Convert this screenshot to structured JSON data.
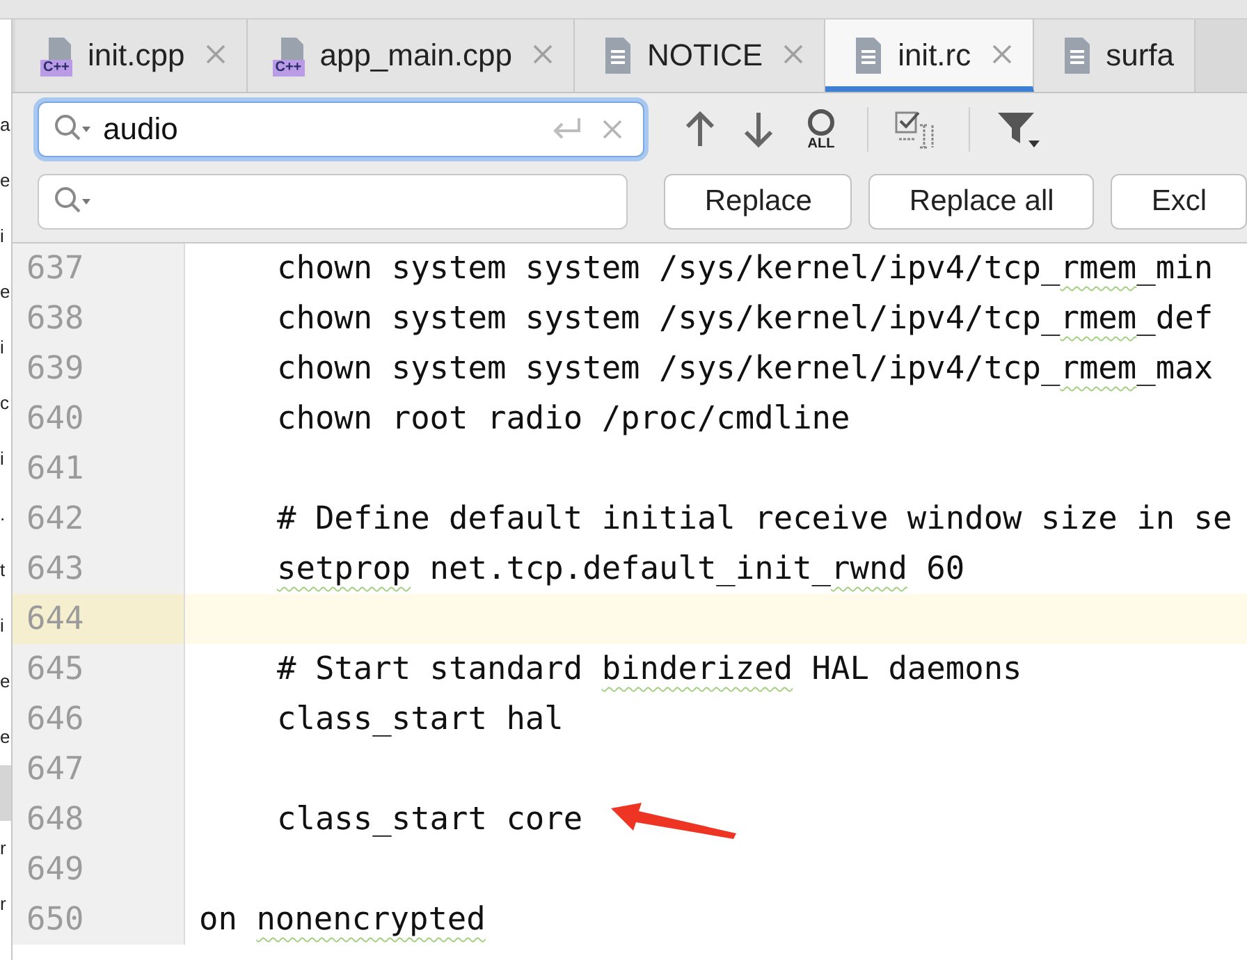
{
  "side_panel": {
    "rows": [
      {
        "text": "a",
        "selected": false
      },
      {
        "text": "e",
        "selected": false
      },
      {
        "text": "i",
        "selected": false
      },
      {
        "text": "e",
        "selected": false
      },
      {
        "text": "i",
        "selected": false
      },
      {
        "text": "c",
        "selected": false
      },
      {
        "text": "i",
        "selected": false
      },
      {
        "text": ".",
        "selected": false
      },
      {
        "text": "t",
        "selected": false
      },
      {
        "text": "i",
        "selected": false
      },
      {
        "text": "e",
        "selected": false
      },
      {
        "text": "e",
        "selected": false
      },
      {
        "selected": true
      },
      {
        "text": "r",
        "selected": false
      },
      {
        "text": "r",
        "selected": false
      }
    ]
  },
  "tabs": [
    {
      "label": "init.cpp",
      "kind": "cpp",
      "badge": "C++",
      "selected": false
    },
    {
      "label": "app_main.cpp",
      "kind": "cpp",
      "badge": "C++",
      "selected": false
    },
    {
      "label": "NOTICE",
      "kind": "text",
      "selected": false
    },
    {
      "label": "init.rc",
      "kind": "text",
      "selected": true
    },
    {
      "label": "surfa",
      "kind": "text",
      "selected": false
    }
  ],
  "find": {
    "value": "audio",
    "select_all_label": "ALL"
  },
  "replace": {
    "buttons": [
      "Replace",
      "Replace all",
      "Excl"
    ]
  },
  "editor": {
    "lines": [
      {
        "number": "637",
        "current": false,
        "indented": true,
        "tokens": [
          {
            "text": "chown system system /sys/kernel/ipv4/tcp_",
            "squiggle": false
          },
          {
            "text": "rmem",
            "squiggle": true
          },
          {
            "text": "_min",
            "squiggle": false
          }
        ]
      },
      {
        "number": "638",
        "current": false,
        "indented": true,
        "tokens": [
          {
            "text": "chown system system /sys/kernel/ipv4/tcp_",
            "squiggle": false
          },
          {
            "text": "rmem",
            "squiggle": true
          },
          {
            "text": "_def",
            "squiggle": false
          }
        ]
      },
      {
        "number": "639",
        "current": false,
        "indented": true,
        "tokens": [
          {
            "text": "chown system system /sys/kernel/ipv4/tcp_",
            "squiggle": false
          },
          {
            "text": "rmem",
            "squiggle": true
          },
          {
            "text": "_max",
            "squiggle": false
          }
        ]
      },
      {
        "number": "640",
        "current": false,
        "indented": true,
        "tokens": [
          {
            "text": "chown root radio /proc/cmdline",
            "squiggle": false
          }
        ]
      },
      {
        "number": "641",
        "current": false
      },
      {
        "number": "642",
        "current": false,
        "indented": true,
        "tokens": [
          {
            "text": "# Define default initial receive window size in se",
            "squiggle": false
          }
        ]
      },
      {
        "number": "643",
        "current": false,
        "indented": true,
        "tokens": [
          {
            "text": "setprop",
            "squiggle": true
          },
          {
            "text": " net.tcp.default_init_",
            "squiggle": false
          },
          {
            "text": "rwnd",
            "squiggle": true
          },
          {
            "text": " 60",
            "squiggle": false
          }
        ]
      },
      {
        "number": "644",
        "current": true
      },
      {
        "number": "645",
        "current": false,
        "indented": true,
        "tokens": [
          {
            "text": "# Start standard ",
            "squiggle": false
          },
          {
            "text": "binderized",
            "squiggle": true
          },
          {
            "text": " HAL daemons",
            "squiggle": false
          }
        ]
      },
      {
        "number": "646",
        "current": false,
        "indented": true,
        "tokens": [
          {
            "text": "class_start hal",
            "squiggle": false
          }
        ]
      },
      {
        "number": "647",
        "current": false
      },
      {
        "number": "648",
        "current": false,
        "indented": true,
        "tokens": [
          {
            "text": "class_start core",
            "squiggle": false
          }
        ]
      },
      {
        "number": "649",
        "current": false
      },
      {
        "number": "650",
        "current": false,
        "indented": false,
        "tokens": [
          {
            "text": "on ",
            "squiggle": false
          },
          {
            "text": "nonencrypted",
            "squiggle": true
          }
        ]
      }
    ],
    "annotation": {
      "kind": "arrow"
    }
  }
}
